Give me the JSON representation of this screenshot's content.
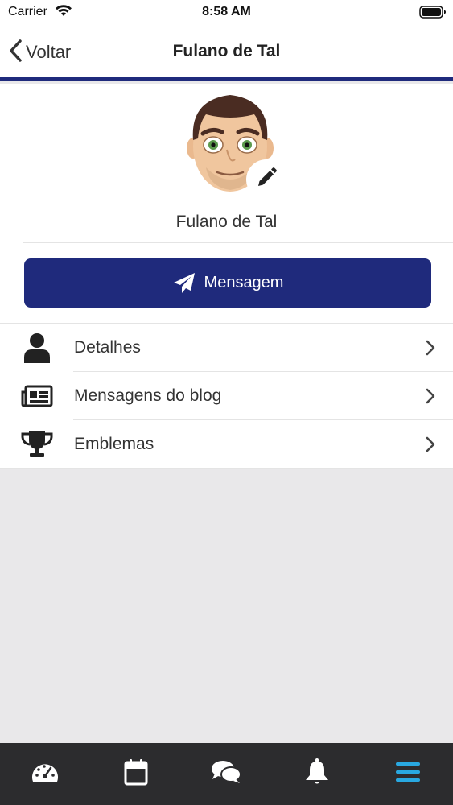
{
  "status": {
    "carrier": "Carrier",
    "time": "8:58 AM"
  },
  "nav": {
    "back_label": "Voltar",
    "title": "Fulano de Tal"
  },
  "profile": {
    "name": "Fulano de Tal"
  },
  "actions": {
    "message_label": "Mensagem"
  },
  "menu": {
    "items": [
      {
        "label": "Detalhes",
        "icon": "user-icon"
      },
      {
        "label": "Mensagens do blog",
        "icon": "newspaper-icon"
      },
      {
        "label": "Emblemas",
        "icon": "trophy-icon"
      }
    ]
  },
  "tabs": [
    {
      "icon": "dashboard-icon",
      "active": false
    },
    {
      "icon": "calendar-icon",
      "active": false
    },
    {
      "icon": "chat-icon",
      "active": false
    },
    {
      "icon": "bell-icon",
      "active": false
    },
    {
      "icon": "menu-icon",
      "active": true
    }
  ],
  "colors": {
    "primary": "#1f2a7c",
    "tab_active": "#29a8e0",
    "tab_bar": "#2c2c2e",
    "background": "#e9e8ea"
  }
}
